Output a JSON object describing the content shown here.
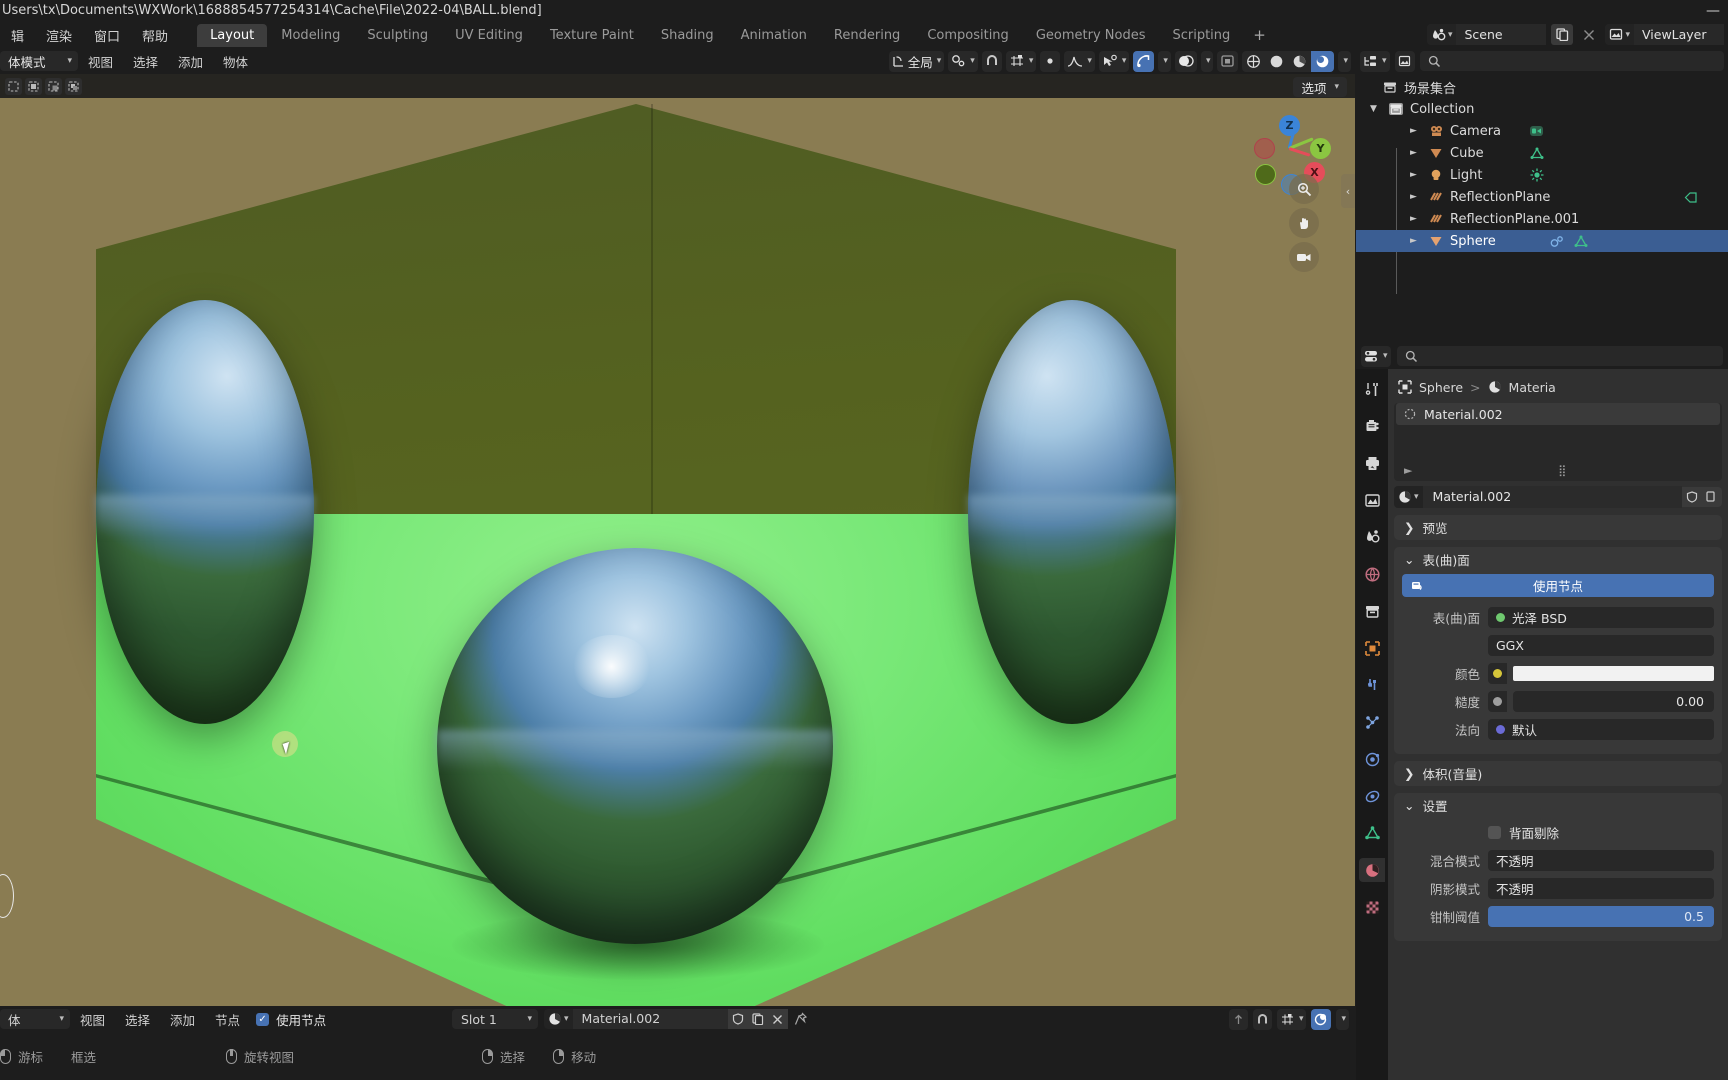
{
  "titlebar": {
    "path": "Users\\tx\\Documents\\WXWork\\1688854577254314\\Cache\\File\\2022-04\\BALL.blend]",
    "minimize": "—"
  },
  "topbar": {
    "menus": [
      "辑",
      "渲染",
      "窗口",
      "帮助"
    ],
    "tabs": [
      {
        "label": "Layout",
        "active": true
      },
      {
        "label": "Modeling",
        "active": false
      },
      {
        "label": "Sculpting",
        "active": false
      },
      {
        "label": "UV Editing",
        "active": false
      },
      {
        "label": "Texture Paint",
        "active": false
      },
      {
        "label": "Shading",
        "active": false
      },
      {
        "label": "Animation",
        "active": false
      },
      {
        "label": "Rendering",
        "active": false
      },
      {
        "label": "Compositing",
        "active": false
      },
      {
        "label": "Geometry Nodes",
        "active": false
      },
      {
        "label": "Scripting",
        "active": false
      }
    ],
    "add_tab": "+",
    "scene_name": "Scene",
    "viewlayer_name": "ViewLayer"
  },
  "viewport_header": {
    "mode": "体模式",
    "menus": [
      "视图",
      "选择",
      "添加",
      "物体"
    ],
    "transform_orientation": "全局",
    "options_label": "选项"
  },
  "viewport": {
    "gizmo_axes": [
      "Z",
      "Y",
      "X"
    ],
    "colors": {
      "axis_z": "#3b84d8",
      "axis_y": "#8bc641",
      "axis_x": "#e54d5a",
      "floor": "#69e268",
      "wall": "#55621f",
      "room": "#8a7c52"
    }
  },
  "outliner": {
    "root": "场景集合",
    "items": [
      {
        "label": "Collection",
        "indent": 0,
        "icon": "collection-icon",
        "selected": false,
        "expanded": true
      },
      {
        "label": "Camera",
        "indent": 1,
        "icon": "camera-object-icon",
        "selected": false,
        "expanded": false
      },
      {
        "label": "Cube",
        "indent": 1,
        "icon": "mesh-cone-icon",
        "selected": false,
        "expanded": false
      },
      {
        "label": "Light",
        "indent": 1,
        "icon": "light-icon",
        "selected": false,
        "expanded": false
      },
      {
        "label": "ReflectionPlane",
        "indent": 1,
        "icon": "lightprobe-icon",
        "selected": false,
        "expanded": false
      },
      {
        "label": "ReflectionPlane.001",
        "indent": 1,
        "icon": "lightprobe-icon",
        "selected": false,
        "expanded": false
      },
      {
        "label": "Sphere",
        "indent": 1,
        "icon": "mesh-data-icon",
        "selected": true,
        "expanded": false
      }
    ]
  },
  "properties": {
    "breadcrumb": {
      "object": "Sphere",
      "material": "Materia"
    },
    "material_slot": "Material.002",
    "material_name": "Material.002",
    "panels": {
      "preview": "预览",
      "surface": "表(曲)面",
      "volume": "体积(音量)",
      "settings": "设置"
    },
    "use_nodes": "使用节点",
    "surface_label": "表(曲)面",
    "surface_value": "光泽 BSD",
    "distribution": "GGX",
    "color_label": "颜色",
    "roughness_label": "糙度",
    "roughness_value": "0.00",
    "normal_label": "法向",
    "normal_value": "默认",
    "backface_culling": "背面剔除",
    "blend_mode_label": "混合模式",
    "blend_mode_value": "不透明",
    "shadow_mode_label": "阴影模式",
    "shadow_mode_value": "不透明",
    "clamp_label": "钳制阈值",
    "clamp_value": "0.5"
  },
  "node_editor_header": {
    "editor_type": "体",
    "menus": [
      "视图",
      "选择",
      "添加",
      "节点"
    ],
    "use_nodes": "使用节点",
    "slot": "Slot 1",
    "material": "Material.002"
  },
  "statusbar": {
    "items": [
      {
        "label": "游标",
        "mouse": "left"
      },
      {
        "label": "框选",
        "mouse": "none"
      },
      {
        "label": "旋转视图",
        "mouse": "middle"
      },
      {
        "label": "选择",
        "mouse": "right"
      },
      {
        "label": "移动",
        "mouse": "right"
      }
    ]
  }
}
